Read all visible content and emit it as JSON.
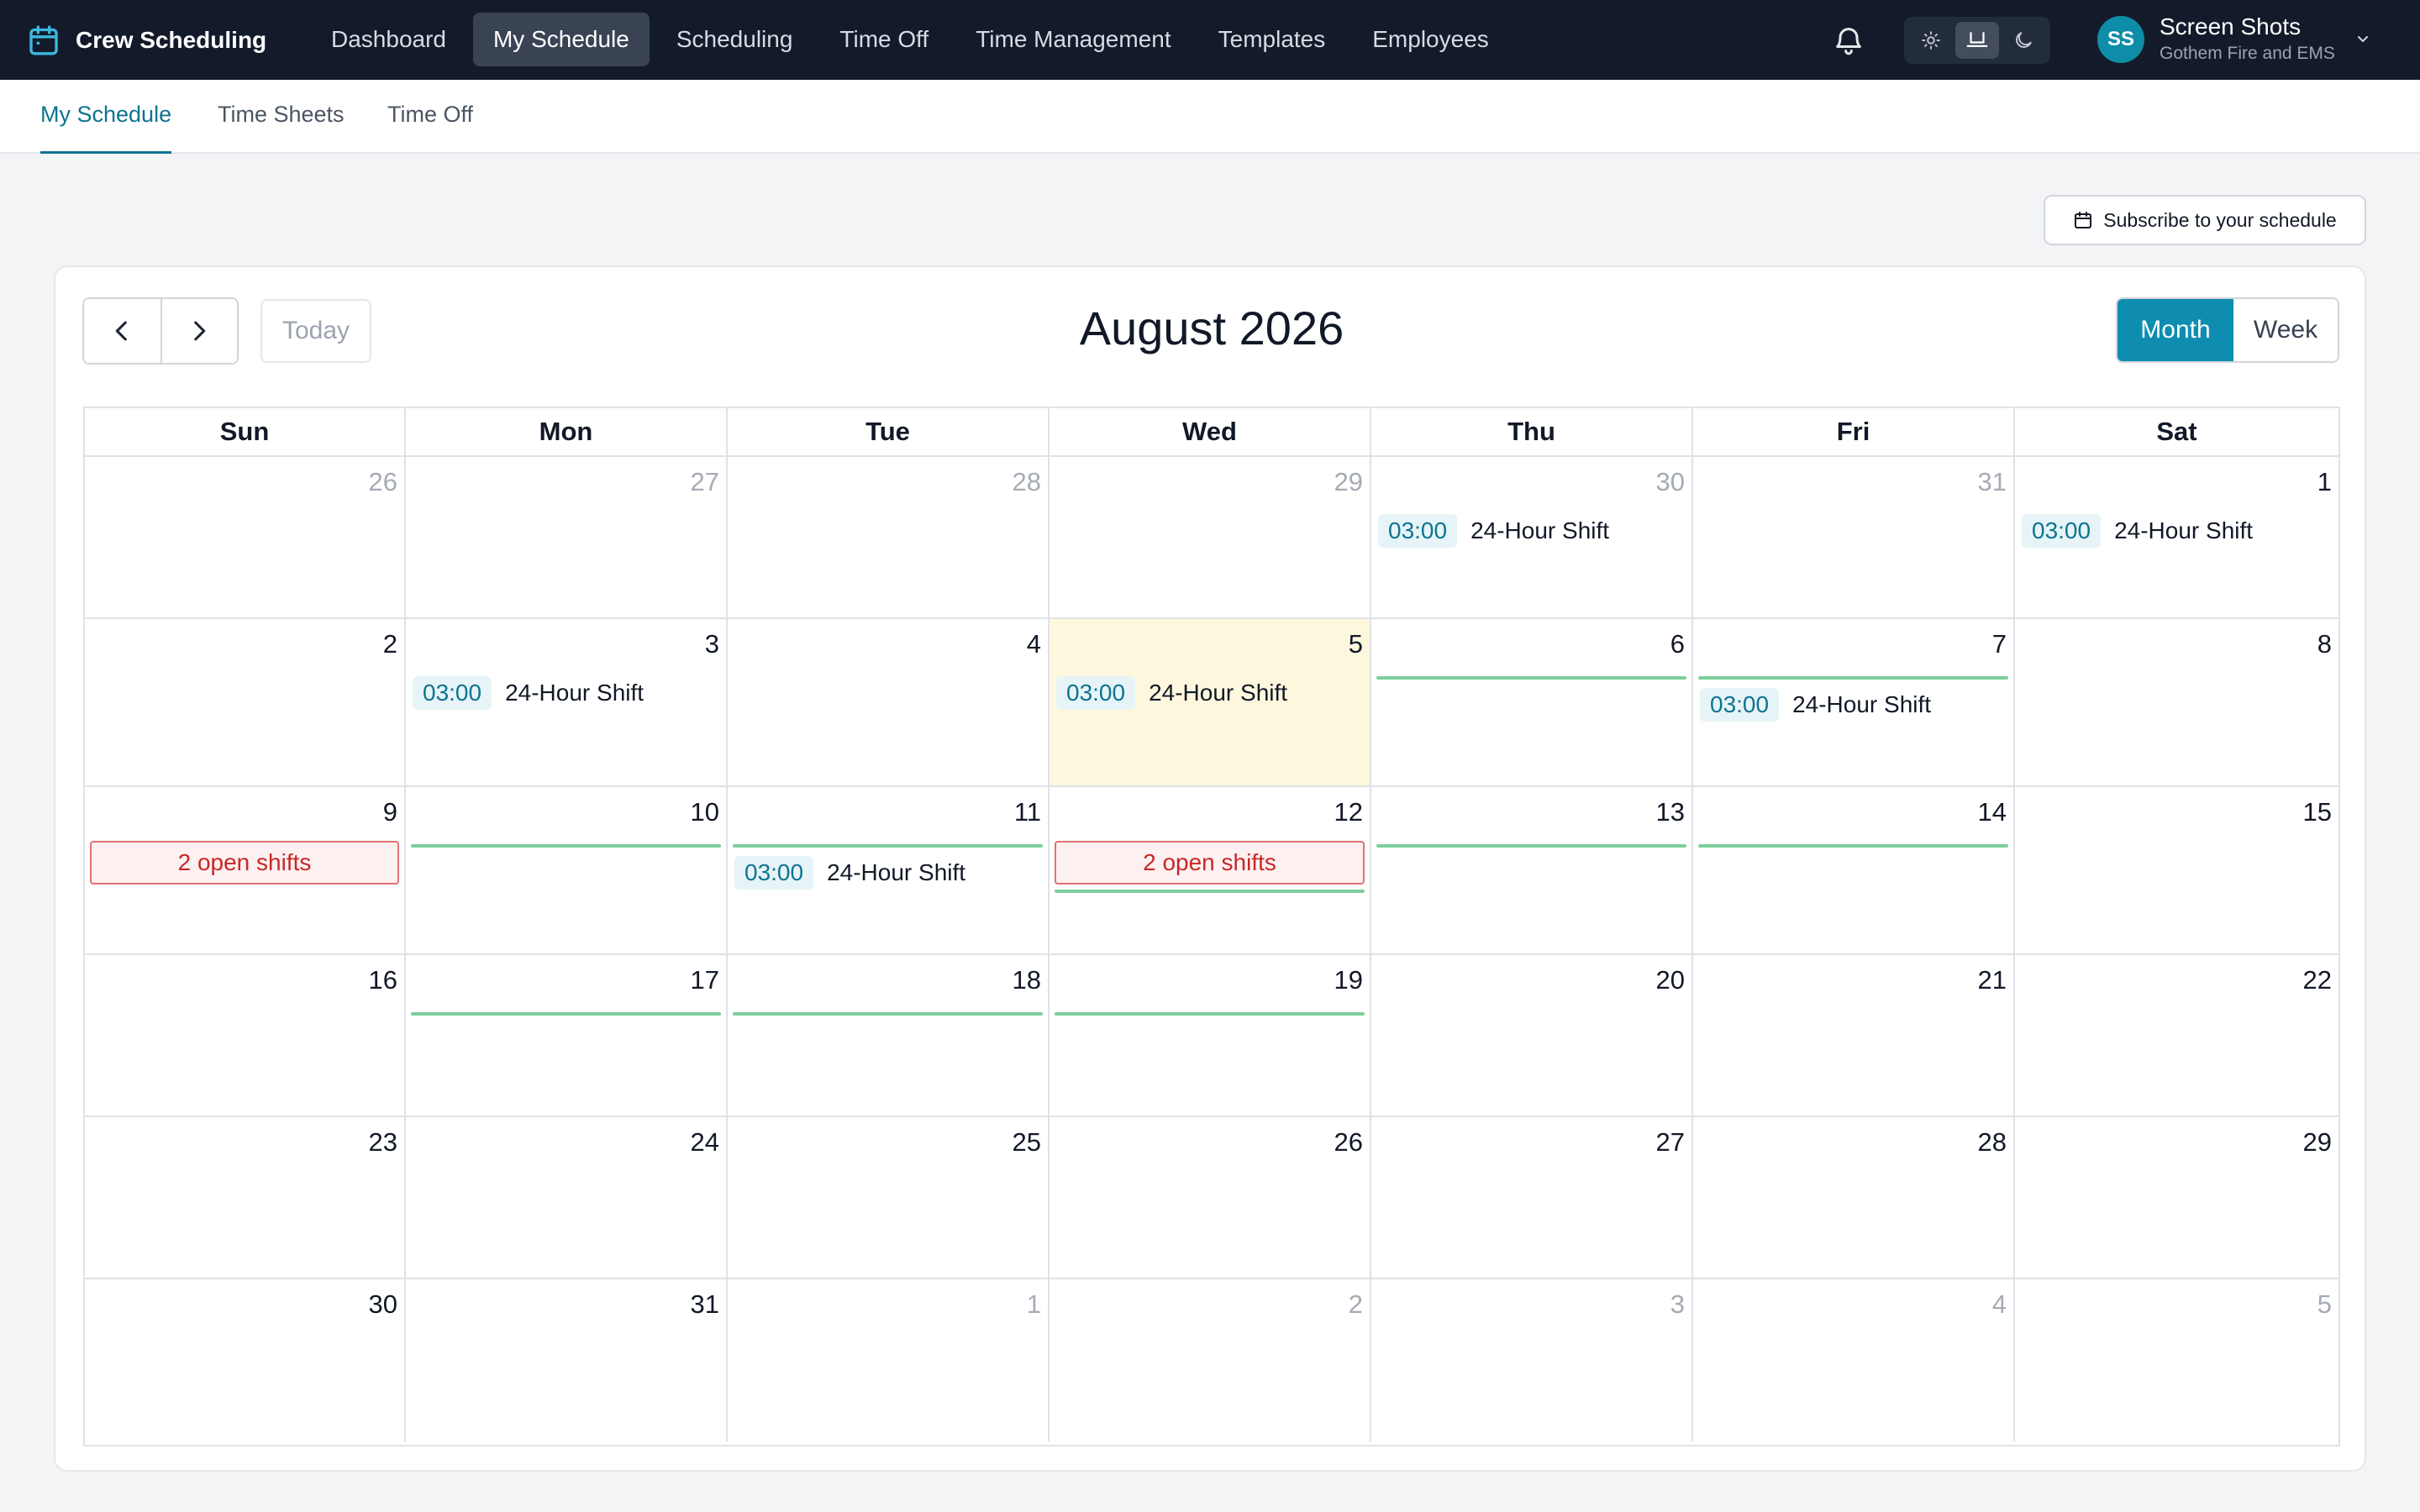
{
  "app": {
    "name": "Crew Scheduling",
    "icon": "calendar-icon"
  },
  "nav": [
    {
      "id": "dashboard",
      "label": "Dashboard",
      "active": false
    },
    {
      "id": "my-schedule",
      "label": "My Schedule",
      "active": true
    },
    {
      "id": "scheduling",
      "label": "Scheduling",
      "active": false
    },
    {
      "id": "time-off",
      "label": "Time Off",
      "active": false
    },
    {
      "id": "time-management",
      "label": "Time Management",
      "active": false
    },
    {
      "id": "templates",
      "label": "Templates",
      "active": false
    },
    {
      "id": "employees",
      "label": "Employees",
      "active": false
    }
  ],
  "header": {
    "notifications_icon": "bell-icon",
    "theme_modes": [
      "light",
      "system",
      "dark"
    ],
    "theme_selected": "system"
  },
  "user": {
    "initials": "SS",
    "name": "Screen Shots",
    "org": "Gothem Fire and EMS"
  },
  "subnav": [
    {
      "id": "my-schedule",
      "label": "My Schedule",
      "active": true
    },
    {
      "id": "time-sheets",
      "label": "Time Sheets",
      "active": false
    },
    {
      "id": "time-off",
      "label": "Time Off",
      "active": false
    }
  ],
  "subscribe_label": "Subscribe to your schedule",
  "calendar": {
    "title": "August 2026",
    "today_label": "Today",
    "view_month": "Month",
    "view_week": "Week",
    "selected_view": "Month",
    "weekdays": [
      "Sun",
      "Mon",
      "Tue",
      "Wed",
      "Thu",
      "Fri",
      "Sat"
    ],
    "colors": {
      "accent": "#0e8db0",
      "shift_time": "#0e7490",
      "open_shift": "#c62828",
      "coverage_line": "#7ccf9b",
      "today_bg": "#fdf8dd"
    },
    "weeks": [
      [
        {
          "day": "26",
          "outside": true
        },
        {
          "day": "27",
          "outside": true
        },
        {
          "day": "28",
          "outside": true
        },
        {
          "day": "29",
          "outside": true
        },
        {
          "day": "30",
          "outside": true,
          "events": [
            {
              "time": "03:00",
              "title": "24-Hour Shift"
            }
          ]
        },
        {
          "day": "31",
          "outside": true
        },
        {
          "day": "1",
          "events": [
            {
              "time": "03:00",
              "title": "24-Hour Shift"
            }
          ]
        }
      ],
      [
        {
          "day": "2"
        },
        {
          "day": "3",
          "events": [
            {
              "time": "03:00",
              "title": "24-Hour Shift"
            }
          ]
        },
        {
          "day": "4"
        },
        {
          "day": "5",
          "today": true,
          "events": [
            {
              "time": "03:00",
              "title": "24-Hour Shift"
            }
          ]
        },
        {
          "day": "6",
          "line": true
        },
        {
          "day": "7",
          "line": true,
          "events": [
            {
              "time": "03:00",
              "title": "24-Hour Shift"
            }
          ]
        },
        {
          "day": "8"
        }
      ],
      [
        {
          "day": "9",
          "open": "2 open shifts"
        },
        {
          "day": "10",
          "line": true
        },
        {
          "day": "11",
          "line": true,
          "events": [
            {
              "time": "03:00",
              "title": "24-Hour Shift"
            }
          ]
        },
        {
          "day": "12",
          "open": "2 open shifts",
          "line": true
        },
        {
          "day": "13",
          "line": true
        },
        {
          "day": "14",
          "line": true
        },
        {
          "day": "15"
        }
      ],
      [
        {
          "day": "16"
        },
        {
          "day": "17",
          "line": true
        },
        {
          "day": "18",
          "line": true
        },
        {
          "day": "19",
          "line": true
        },
        {
          "day": "20"
        },
        {
          "day": "21"
        },
        {
          "day": "22"
        }
      ],
      [
        {
          "day": "23"
        },
        {
          "day": "24"
        },
        {
          "day": "25"
        },
        {
          "day": "26"
        },
        {
          "day": "27"
        },
        {
          "day": "28"
        },
        {
          "day": "29"
        }
      ],
      [
        {
          "day": "30"
        },
        {
          "day": "31"
        },
        {
          "day": "1",
          "outside": true
        },
        {
          "day": "2",
          "outside": true
        },
        {
          "day": "3",
          "outside": true
        },
        {
          "day": "4",
          "outside": true
        },
        {
          "day": "5",
          "outside": true
        }
      ]
    ]
  }
}
